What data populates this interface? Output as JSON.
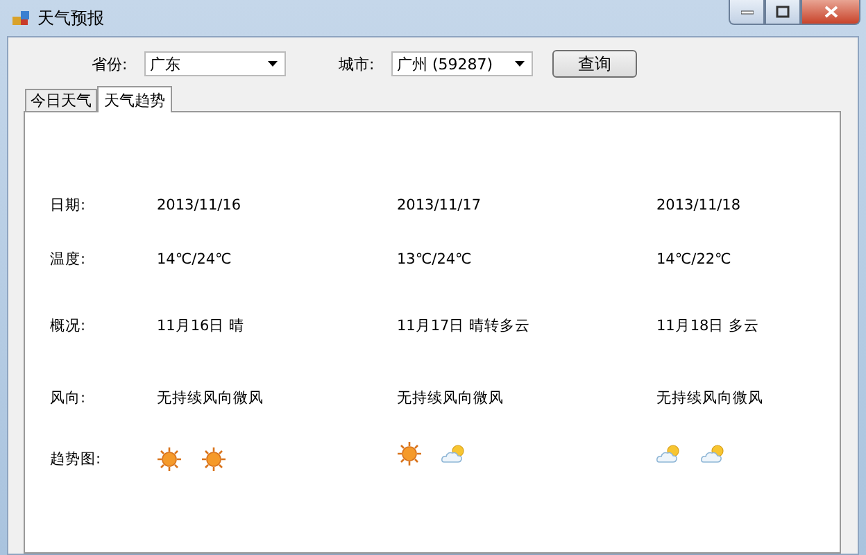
{
  "window": {
    "title": "天气预报"
  },
  "query": {
    "province_label": "省份:",
    "province": "广东",
    "city_label": "城市:",
    "city": "广州 (59287)",
    "button": "查询"
  },
  "tabs": [
    {
      "label": "今日天气",
      "selected": false
    },
    {
      "label": "天气趋势",
      "selected": true
    }
  ],
  "row_labels": [
    "日期:",
    "温度:",
    "概况:",
    "风向:",
    "趋势图:"
  ],
  "days": [
    {
      "date": "2013/11/16",
      "temperature": "14℃/24℃",
      "summary": "11月16日 晴",
      "wind": "无持续风向微风",
      "icons": [
        {
          "kind": "sun"
        },
        {
          "kind": "sun"
        }
      ]
    },
    {
      "date": "2013/11/17",
      "temperature": "13℃/24℃",
      "summary": "11月17日 晴转多云",
      "wind": "无持续风向微风",
      "icons": [
        {
          "kind": "sun"
        },
        {
          "kind": "partly-cloudy"
        }
      ]
    },
    {
      "date": "2013/11/18",
      "temperature": "14℃/22℃",
      "summary": "11月18日 多云",
      "wind": "无持续风向微风",
      "icons": [
        {
          "kind": "partly-cloudy"
        },
        {
          "kind": "partly-cloudy"
        }
      ]
    }
  ]
}
